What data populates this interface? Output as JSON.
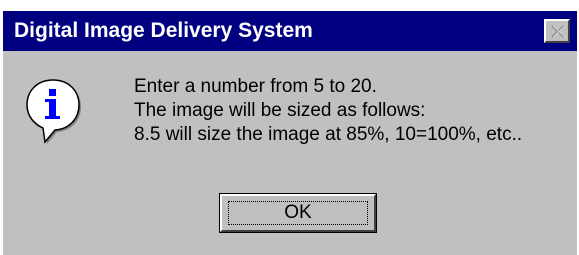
{
  "window": {
    "title": "Digital Image Delivery System",
    "close_icon": "close-icon"
  },
  "message": {
    "icon": "info-icon",
    "line1": "Enter a number from 5 to 20.",
    "line2": "The image will be sized as follows:",
    "line3": "8.5 will size the image at 85%, 10=100%, etc.."
  },
  "buttons": {
    "ok_label": "OK"
  },
  "colors": {
    "titlebar": "#000080",
    "dialog_face": "#c0c0c0",
    "icon_blue": "#0000ff"
  }
}
